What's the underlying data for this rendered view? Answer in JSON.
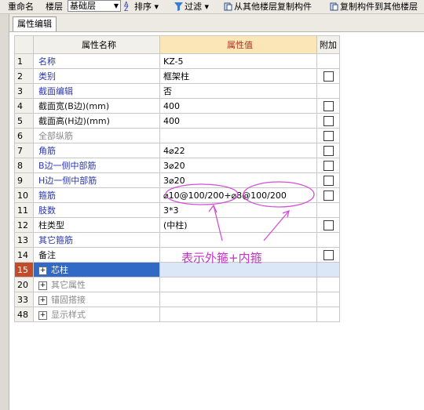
{
  "toolbar": {
    "rename": "重命名",
    "floor_label": "楼层",
    "floor_value": "基础层",
    "sort": "排序",
    "filter": "过滤",
    "copy_from_other": "从其他楼层复制构件",
    "copy_to_other": "复制构件到其他楼层"
  },
  "tab": {
    "label": "属性编辑"
  },
  "table": {
    "headers": {
      "name": "属性名称",
      "value": "属性值",
      "add": "附加"
    },
    "rows": [
      {
        "num": "1",
        "name": "名称",
        "value": "KZ-5",
        "checkbox": false,
        "expander": false,
        "style": "blue"
      },
      {
        "num": "2",
        "name": "类别",
        "value": "框架柱",
        "checkbox": true,
        "expander": false,
        "style": "blue"
      },
      {
        "num": "3",
        "name": "截面编辑",
        "value": "否",
        "checkbox": false,
        "expander": false,
        "style": "blue"
      },
      {
        "num": "4",
        "name": "截面宽(B边)(mm)",
        "value": "400",
        "checkbox": true,
        "expander": false,
        "style": "black"
      },
      {
        "num": "5",
        "name": "截面高(H边)(mm)",
        "value": "400",
        "checkbox": true,
        "expander": false,
        "style": "black"
      },
      {
        "num": "6",
        "name": "全部纵筋",
        "value": "",
        "checkbox": true,
        "expander": false,
        "style": "gray"
      },
      {
        "num": "7",
        "name": "角筋",
        "value": "4⌀22",
        "checkbox": true,
        "expander": false,
        "style": "blue"
      },
      {
        "num": "8",
        "name": "B边一侧中部筋",
        "value": "3⌀20",
        "checkbox": true,
        "expander": false,
        "style": "blue"
      },
      {
        "num": "9",
        "name": "H边一侧中部筋",
        "value": "3⌀20",
        "checkbox": true,
        "expander": false,
        "style": "blue"
      },
      {
        "num": "10",
        "name": "箍筋",
        "value": "⌀10@100/200+⌀8@100/200",
        "checkbox": true,
        "expander": false,
        "style": "blue"
      },
      {
        "num": "11",
        "name": "肢数",
        "value": "3*3",
        "checkbox": false,
        "expander": false,
        "style": "blue"
      },
      {
        "num": "12",
        "name": "柱类型",
        "value": "(中柱)",
        "checkbox": true,
        "expander": false,
        "style": "black"
      },
      {
        "num": "13",
        "name": "其它箍筋",
        "value": "",
        "checkbox": false,
        "expander": false,
        "style": "blue"
      },
      {
        "num": "14",
        "name": "备注",
        "value": "",
        "checkbox": true,
        "expander": false,
        "style": "black"
      },
      {
        "num": "15",
        "name": "芯柱",
        "value": "",
        "checkbox": false,
        "expander": true,
        "style": "selected"
      },
      {
        "num": "20",
        "name": "其它属性",
        "value": "",
        "checkbox": false,
        "expander": true,
        "style": "gray"
      },
      {
        "num": "33",
        "name": "锚固搭接",
        "value": "",
        "checkbox": false,
        "expander": true,
        "style": "gray"
      },
      {
        "num": "48",
        "name": "显示样式",
        "value": "",
        "checkbox": false,
        "expander": true,
        "style": "gray"
      }
    ]
  },
  "annotation": {
    "text": "表示外箍+内箍",
    "color": "#c434c4"
  }
}
